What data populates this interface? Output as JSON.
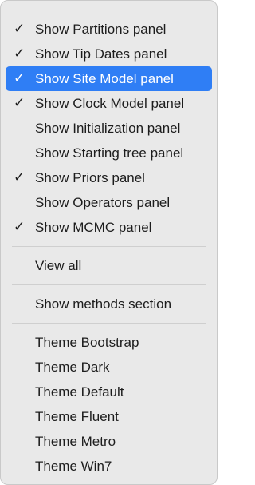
{
  "menu": {
    "panel_items": [
      {
        "label": "Show Partitions panel",
        "checked": true,
        "highlighted": false
      },
      {
        "label": "Show Tip Dates panel",
        "checked": true,
        "highlighted": false
      },
      {
        "label": "Show Site Model panel",
        "checked": true,
        "highlighted": true
      },
      {
        "label": "Show Clock Model panel",
        "checked": true,
        "highlighted": false
      },
      {
        "label": "Show Initialization panel",
        "checked": false,
        "highlighted": false
      },
      {
        "label": "Show Starting tree panel",
        "checked": false,
        "highlighted": false
      },
      {
        "label": "Show Priors panel",
        "checked": true,
        "highlighted": false
      },
      {
        "label": "Show Operators panel",
        "checked": false,
        "highlighted": false
      },
      {
        "label": "Show MCMC panel",
        "checked": true,
        "highlighted": false
      }
    ],
    "view_all_label": "View all",
    "methods_label": "Show methods section",
    "theme_items": [
      {
        "label": "Theme Bootstrap"
      },
      {
        "label": "Theme Dark"
      },
      {
        "label": "Theme Default"
      },
      {
        "label": "Theme Fluent"
      },
      {
        "label": "Theme Metro"
      },
      {
        "label": "Theme Win7"
      }
    ],
    "checkmark_glyph": "✓",
    "highlight_color": "#2f7ef5"
  }
}
